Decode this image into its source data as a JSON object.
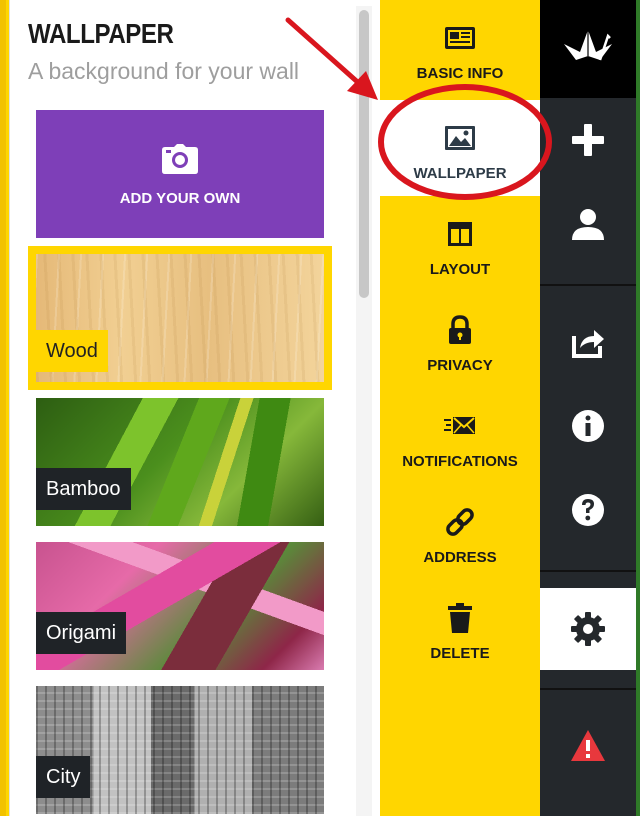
{
  "panel": {
    "title": "WALLPAPER",
    "subtitle": "A background for your wall",
    "add_own": {
      "label": "ADD YOUR OWN",
      "icon": "camera-icon"
    },
    "wallpapers": [
      {
        "label": "Wood",
        "selected": true
      },
      {
        "label": "Bamboo",
        "selected": false
      },
      {
        "label": "Origami",
        "selected": false
      },
      {
        "label": "City",
        "selected": false
      }
    ]
  },
  "nav": {
    "items": [
      {
        "label": "BASIC INFO",
        "icon": "newspaper-icon"
      },
      {
        "label": "WALLPAPER",
        "icon": "image-icon",
        "active": true
      },
      {
        "label": "LAYOUT",
        "icon": "layout-icon"
      },
      {
        "label": "PRIVACY",
        "icon": "lock-icon"
      },
      {
        "label": "NOTIFICATIONS",
        "icon": "envelope-icon"
      },
      {
        "label": "ADDRESS",
        "icon": "link-icon"
      },
      {
        "label": "DELETE",
        "icon": "trash-icon"
      }
    ]
  },
  "rail": {
    "logo_icon": "paper-crane-icon",
    "buttons": [
      "plus-icon",
      "user-icon",
      "share-icon",
      "info-icon",
      "help-icon",
      "gear-icon",
      "warning-icon"
    ],
    "active": "gear-icon"
  },
  "colors": {
    "accent_yellow": "#ffd600",
    "add_own_purple": "#7e3fb8",
    "rail_dark": "#24282c",
    "annotation_red": "#d9161e",
    "warning_red": "#e8383d"
  }
}
